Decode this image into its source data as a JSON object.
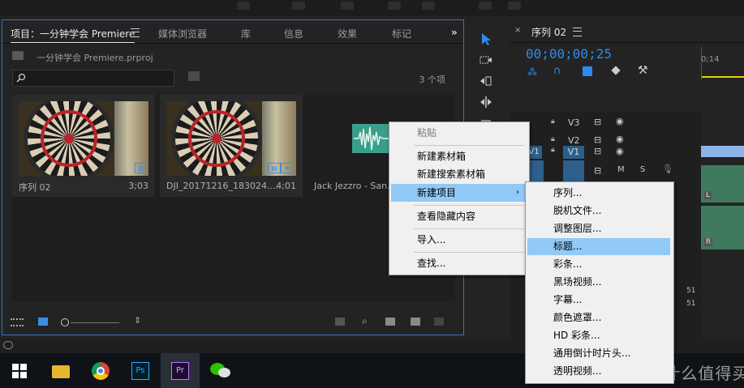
{
  "project_panel": {
    "tabs": [
      "项目：一分钟学会 Premiere",
      "媒体浏览器",
      "库",
      "信息",
      "效果",
      "标记"
    ],
    "overflow_label": "»",
    "project_file": "一分钟学会 Premiere.prproj",
    "item_count": "3 个项",
    "search_placeholder": "",
    "items": [
      {
        "name": "序列 02",
        "duration": "3;03"
      },
      {
        "name": "DJI_20171216_183024....",
        "duration": "4;01"
      },
      {
        "name": "Jack Jezzro - San..."
      }
    ]
  },
  "timeline": {
    "title": "序列 02",
    "timecode": "00;00;00;25",
    "ruler_label": "0;14",
    "tracks": [
      "V3",
      "V2",
      "V1"
    ],
    "source_patch": "V1",
    "audio_buttons": [
      "M",
      "S"
    ],
    "audio_channel_labels": [
      "L",
      "R"
    ],
    "meter_labels": [
      "51",
      "51"
    ]
  },
  "context_menu": {
    "items": [
      {
        "label": "粘贴",
        "disabled": true
      },
      {
        "label": "新建素材箱"
      },
      {
        "label": "新建搜索素材箱"
      },
      {
        "label": "新建项目",
        "submenu": true,
        "highlighted": true
      },
      {
        "label": "查看隐藏内容"
      },
      {
        "label": "导入..."
      },
      {
        "label": "查找..."
      }
    ]
  },
  "submenu": {
    "items": [
      {
        "label": "序列..."
      },
      {
        "label": "脱机文件..."
      },
      {
        "label": "调整图层..."
      },
      {
        "label": "标题...",
        "highlighted": true
      },
      {
        "label": "彩条..."
      },
      {
        "label": "黑场视频..."
      },
      {
        "label": "字幕..."
      },
      {
        "label": "颜色遮罩..."
      },
      {
        "label": "HD 彩条..."
      },
      {
        "label": "通用倒计时片头..."
      },
      {
        "label": "透明视频..."
      }
    ]
  },
  "taskbar": {
    "apps": [
      "windows-start",
      "file-explorer",
      "chrome",
      "photoshop",
      "premiere",
      "wechat"
    ],
    "ps_label": "Ps",
    "pr_label": "Pr"
  },
  "watermark": "值 什么值得买",
  "colors": {
    "accent_blue": "#3a72c4",
    "timecode_blue": "#2b8cf0",
    "menu_highlight": "#91c9f7",
    "menu_bg": "#f0f0f0"
  }
}
